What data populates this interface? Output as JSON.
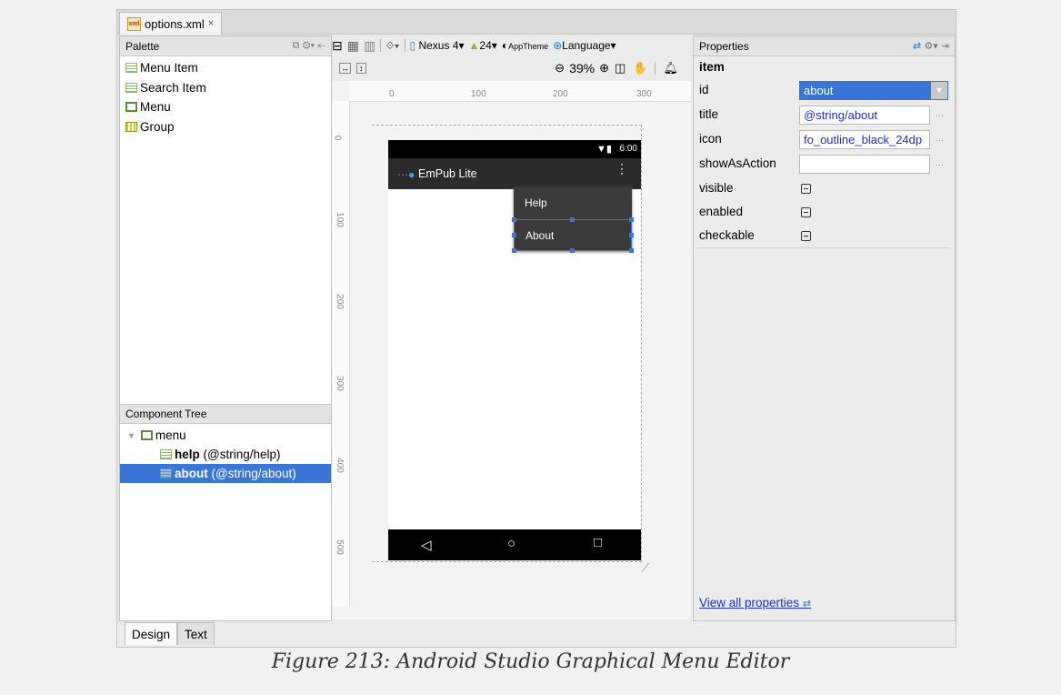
{
  "file_tab": {
    "name": "options.xml",
    "close": "×"
  },
  "palette": {
    "title": "Palette",
    "items": [
      {
        "label": "Menu Item",
        "icon": "menu-item-icon"
      },
      {
        "label": "Search Item",
        "icon": "menu-item-icon"
      },
      {
        "label": "Menu",
        "icon": "menu-icon"
      },
      {
        "label": "Group",
        "icon": "group-icon"
      }
    ]
  },
  "component_tree": {
    "title": "Component Tree",
    "root": "menu",
    "children": [
      {
        "bold": "help",
        "rest": " (@string/help)",
        "selected": false
      },
      {
        "bold": "about",
        "rest": " (@string/about)",
        "selected": true
      }
    ]
  },
  "toolbar": {
    "device": "Nexus 4",
    "api": "24",
    "theme": "AppTheme",
    "language": "Language"
  },
  "zoom": {
    "value": "39%"
  },
  "rulers": {
    "h": [
      "0",
      "100",
      "200",
      "300"
    ],
    "v": [
      "0",
      "100",
      "200",
      "300",
      "400",
      "500"
    ]
  },
  "device_preview": {
    "time": "6:00",
    "app_title": "EmPub Lite",
    "menu_items": [
      "Help",
      "About"
    ],
    "nav": [
      "◁",
      "○",
      "□"
    ]
  },
  "properties": {
    "title": "Properties",
    "section": "item",
    "rows": [
      {
        "label": "id",
        "value": "about"
      },
      {
        "label": "title",
        "value": "@string/about"
      },
      {
        "label": "icon",
        "value": "fo_outline_black_24dp"
      },
      {
        "label": "showAsAction",
        "value": ""
      },
      {
        "label": "visible"
      },
      {
        "label": "enabled"
      },
      {
        "label": "checkable"
      }
    ],
    "view_all": "View all properties"
  },
  "bottom_tabs": [
    "Design",
    "Text"
  ],
  "caption": "Figure 213: Android Studio Graphical Menu Editor",
  "colors": {
    "selection": "#3875d7",
    "link": "#1b2fd0",
    "app_bar": "#2b2b2b"
  }
}
